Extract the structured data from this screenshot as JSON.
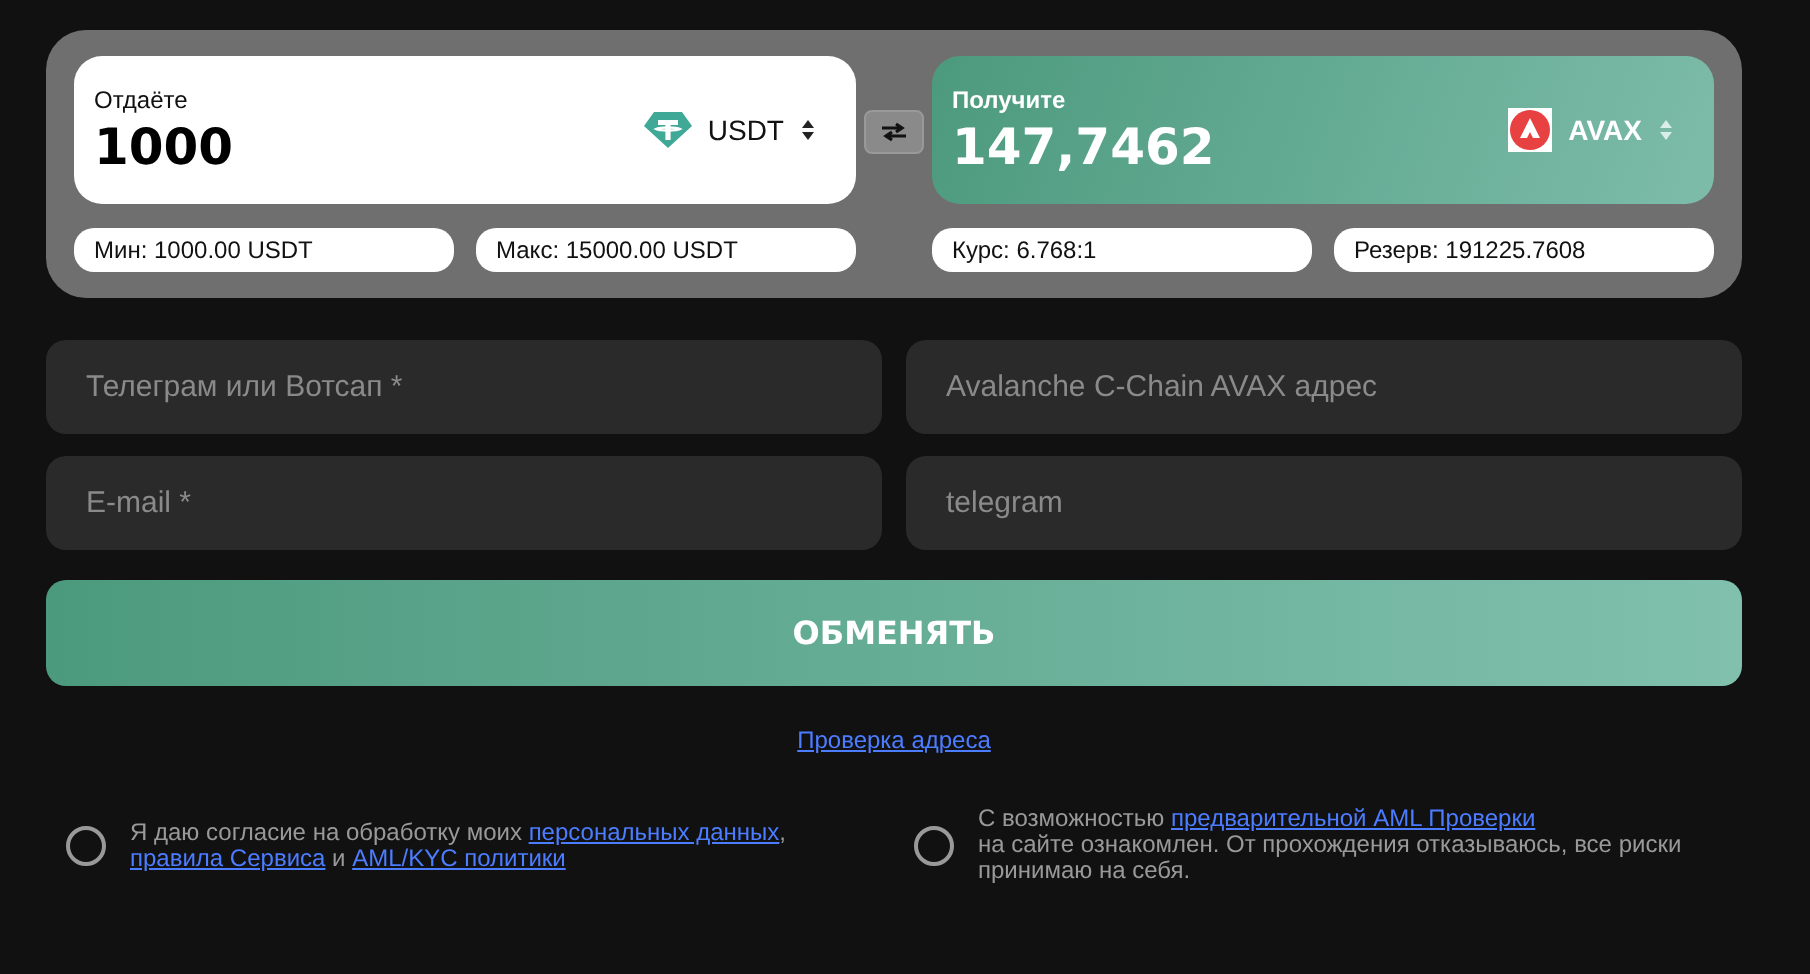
{
  "give": {
    "label": "Отдаёте",
    "amount": "1000",
    "currency": "USDT",
    "min": "Мин: 1000.00 USDT",
    "max": "Макс: 15000.00 USDT"
  },
  "receive": {
    "label": "Получите",
    "amount": "147,7462",
    "currency": "AVAX",
    "rate": "Курс: 6.768:1",
    "reserve": "Резерв: 191225.7608"
  },
  "fields": [
    {
      "placeholder": "Телеграм или Вотсап *"
    },
    {
      "placeholder": "Avalanche C-Chain AVAX адрес"
    },
    {
      "placeholder": "E-mail *"
    },
    {
      "placeholder": "telegram"
    }
  ],
  "submit": "ОБМЕНЯТЬ",
  "check_link": "Проверка адреса",
  "consents": [
    {
      "checked": false,
      "parts": [
        {
          "kind": "text",
          "text": "Я даю согласие на обработку моих "
        },
        {
          "kind": "link",
          "text": "персональных данных"
        },
        {
          "kind": "text",
          "text": ", "
        },
        {
          "kind": "link",
          "text": "правила Сервиса"
        },
        {
          "kind": "text",
          "text": " и "
        },
        {
          "kind": "link",
          "text": "AML/KYC политики"
        }
      ]
    },
    {
      "checked": false,
      "parts": [
        {
          "kind": "text",
          "text": "С возможностью "
        },
        {
          "kind": "link",
          "text": "предварительной AML Проверки"
        },
        {
          "kind": "break"
        },
        {
          "kind": "text",
          "text": "на сайте ознакомлен. От прохождения отказываюсь, все риски принимаю на себя."
        }
      ]
    }
  ]
}
